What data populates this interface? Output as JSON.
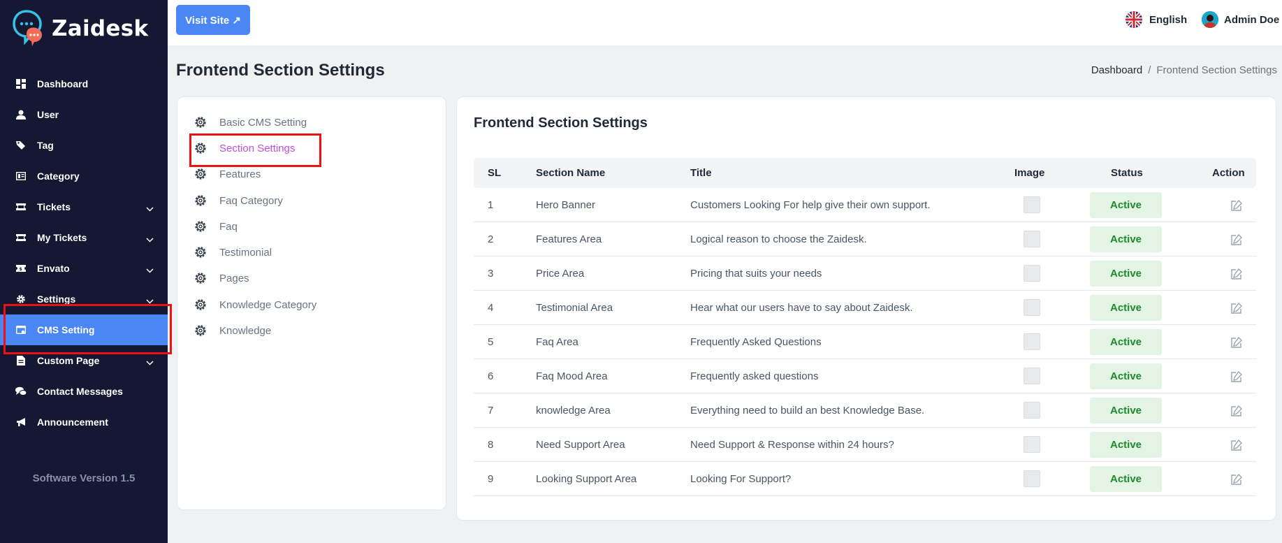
{
  "app": {
    "name": "Zaidesk",
    "version": "Software Version 1.5"
  },
  "sidebar": {
    "items": [
      {
        "label": "Dashboard",
        "icon": "dashboard-icon",
        "chevron": false
      },
      {
        "label": "User",
        "icon": "user-icon",
        "chevron": false
      },
      {
        "label": "Tag",
        "icon": "tag-icon",
        "chevron": false
      },
      {
        "label": "Category",
        "icon": "category-icon",
        "chevron": false
      },
      {
        "label": "Tickets",
        "icon": "ticket-icon",
        "chevron": true
      },
      {
        "label": "My Tickets",
        "icon": "ticket-icon",
        "chevron": true
      },
      {
        "label": "Envato",
        "icon": "envato-icon",
        "chevron": true
      },
      {
        "label": "Settings",
        "icon": "gear-icon",
        "chevron": true
      },
      {
        "label": "CMS Setting",
        "icon": "cms-icon",
        "chevron": false,
        "active": true
      },
      {
        "label": "Custom Page",
        "icon": "page-icon",
        "chevron": true
      },
      {
        "label": "Contact Messages",
        "icon": "messages-icon",
        "chevron": false
      },
      {
        "label": "Announcement",
        "icon": "megaphone-icon",
        "chevron": false
      }
    ]
  },
  "topbar": {
    "visit_site": "Visit Site ↗",
    "language": "English",
    "user_name": "Admin Doe"
  },
  "page": {
    "title": "Frontend Section Settings",
    "breadcrumb": {
      "home": "Dashboard",
      "separator": "/",
      "current": "Frontend Section Settings"
    }
  },
  "settings_menu": [
    {
      "label": "Basic CMS Setting"
    },
    {
      "label": "Section Settings",
      "active": true
    },
    {
      "label": "Features"
    },
    {
      "label": "Faq Category"
    },
    {
      "label": "Faq"
    },
    {
      "label": "Testimonial"
    },
    {
      "label": "Pages"
    },
    {
      "label": "Knowledge Category"
    },
    {
      "label": "Knowledge"
    }
  ],
  "table": {
    "title": "Frontend Section Settings",
    "headers": {
      "sl": "SL",
      "name": "Section Name",
      "title": "Title",
      "image": "Image",
      "status": "Status",
      "action": "Action"
    },
    "rows": [
      {
        "sl": "1",
        "name": "Hero Banner",
        "title": "Customers Looking For help give their own support.",
        "status": "Active"
      },
      {
        "sl": "2",
        "name": "Features Area",
        "title": "Logical reason to choose the Zaidesk.",
        "status": "Active"
      },
      {
        "sl": "3",
        "name": "Price Area",
        "title": "Pricing that suits your needs",
        "status": "Active"
      },
      {
        "sl": "4",
        "name": "Testimonial Area",
        "title": "Hear what our users have to say about Zaidesk.",
        "status": "Active"
      },
      {
        "sl": "5",
        "name": "Faq Area",
        "title": "Frequently Asked Questions",
        "status": "Active"
      },
      {
        "sl": "6",
        "name": "Faq Mood Area",
        "title": "Frequently asked questions",
        "status": "Active"
      },
      {
        "sl": "7",
        "name": "knowledge Area",
        "title": "Everything need to build an best Knowledge Base.",
        "status": "Active"
      },
      {
        "sl": "8",
        "name": "Need Support Area",
        "title": "Need Support & Response within 24 hours?",
        "status": "Active"
      },
      {
        "sl": "9",
        "name": "Looking Support Area",
        "title": "Looking For Support?",
        "status": "Active"
      }
    ]
  },
  "colors": {
    "sidebar_bg": "#141833",
    "accent": "#4a87f5",
    "active_menu": "#c14ee0",
    "status_green": "#1d8a2d",
    "highlight": "#ee1111"
  }
}
